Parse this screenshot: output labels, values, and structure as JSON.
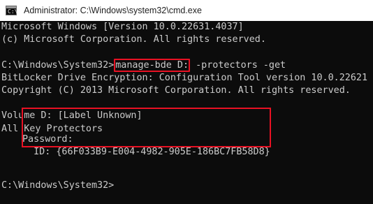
{
  "window": {
    "title": "Administrator: C:\\Windows\\system32\\cmd.exe",
    "icon_text": "C:\\"
  },
  "console": {
    "lines": [
      "Microsoft Windows [Version 10.0.22631.4037]",
      "(c) Microsoft Corporation. All rights reserved.",
      "",
      "",
      "BitLocker Drive Encryption: Configuration Tool version 10.0.22621",
      "Copyright (C) 2013 Microsoft Corporation. All rights reserved.",
      "",
      "Volume D: [Label Unknown]",
      "All Key Protectors"
    ],
    "prompt": "C:\\Windows\\System32>",
    "command_highlighted": "manage-bde D:",
    "command_rest": " -protectors -get",
    "password_label": "Password:",
    "id_line": "  ID: {66F033B9-E004-4982-905E-186BC7FB58D8}",
    "final_prompt": "C:\\Windows\\System32>"
  },
  "colors": {
    "background": "#0c0c0c",
    "text": "#cccccc",
    "highlight_border": "#e81123",
    "titlebar": "#ffffff"
  }
}
